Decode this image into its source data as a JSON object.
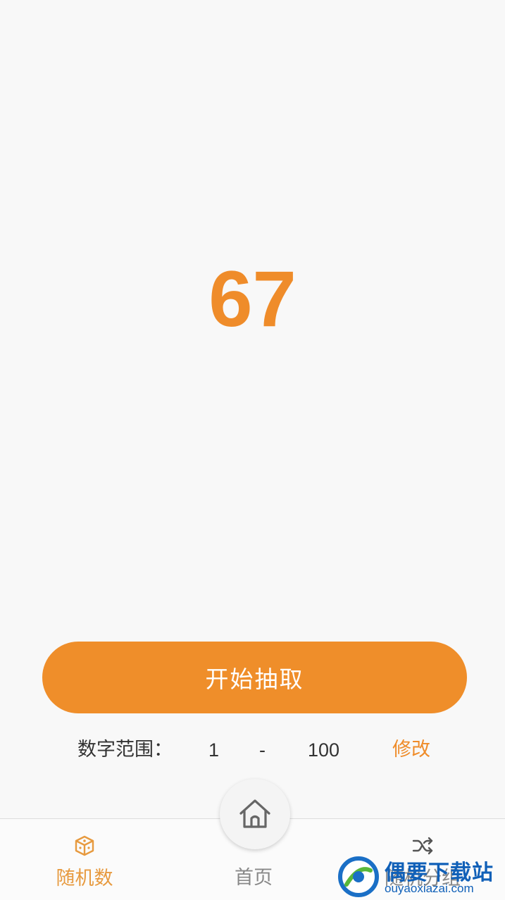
{
  "result": {
    "value": "67"
  },
  "draw_button": {
    "label": "开始抽取"
  },
  "range": {
    "label": "数字范围：",
    "min": "1",
    "separator": "-",
    "max": "100",
    "edit_label": "修改"
  },
  "tabs": [
    {
      "label": "随机数",
      "icon": "dice-icon",
      "active": true
    },
    {
      "label": "首页",
      "icon": "home-icon",
      "active": false
    },
    {
      "label": "随机分组",
      "icon": "shuffle-icon",
      "active": false
    }
  ],
  "watermark": {
    "title": "偶要下载站",
    "url": "ouyaoxiazai.com"
  },
  "colors": {
    "accent": "#ef8e2a",
    "background": "#f8f8f8",
    "inactive": "#888888"
  }
}
